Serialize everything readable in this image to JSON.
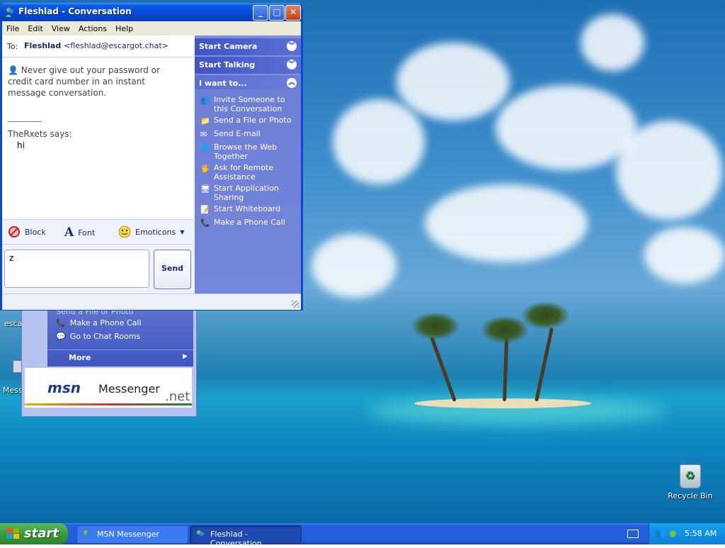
{
  "window": {
    "title": "Fleshlad - Conversation",
    "menu": [
      "File",
      "Edit",
      "View",
      "Actions",
      "Help"
    ],
    "to_label": "To:",
    "to_name": "Fleshlad",
    "to_email": "<fleshlad@escargot.chat>",
    "warning": "Never give out your password or credit card number in an instant message conversation.",
    "sender_says": "TheRxets says:",
    "message": "hi",
    "toolbar": {
      "block": "Block",
      "font": "Font",
      "emoticons": "Emoticons"
    },
    "input_value": "z",
    "send_label": "Send",
    "pane": {
      "start_camera": "Start Camera",
      "start_talking": "Start Talking",
      "i_want_to": "I want to...",
      "items": [
        "Invite Someone to this Conversation",
        "Send a File or Photo",
        "Send E-mail",
        "Browse the Web Together",
        "Ask for Remote Assistance",
        "Start Application Sharing",
        "Start Whiteboard",
        "Make a Phone Call"
      ]
    }
  },
  "background_window": {
    "partial_item": "Send a File or Photo",
    "items": [
      "Make a Phone Call",
      "Go to Chat Rooms"
    ],
    "more": "More",
    "logo_msn": "msn",
    "logo_messenger": "Messenger",
    "logo_net": ".net"
  },
  "desktop": {
    "left_icon_labels": [
      "escar",
      "Messe"
    ],
    "recycle_bin": "Recycle Bin"
  },
  "taskbar": {
    "start": "start",
    "tasks": [
      "MSN Messenger",
      "Fleshlad - Conversation"
    ],
    "clock": "5:58 AM"
  }
}
